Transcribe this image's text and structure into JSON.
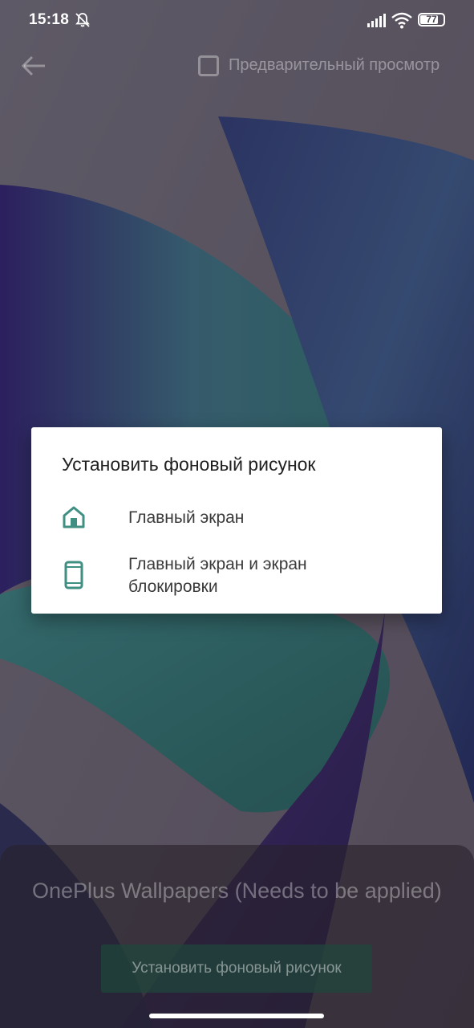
{
  "status_bar": {
    "time": "15:18",
    "battery_level": "77",
    "icons": [
      "bell-off-icon",
      "signal-icon",
      "wifi-icon",
      "battery-icon"
    ]
  },
  "toolbar": {
    "back_icon": "arrow-left-icon",
    "preview_label": "Предварительный просмотр",
    "preview_checked": false
  },
  "wallpaper": {
    "name": "OnePlus Wallpapers (Needs to be applied)",
    "button_label": "Установить фоновый рисунок"
  },
  "dialog": {
    "title": "Установить фоновый рисунок",
    "accent_color": "#3f8f82",
    "options": [
      {
        "icon": "home-icon",
        "label": "Главный экран"
      },
      {
        "icon": "phone-icon",
        "label": "Главный экран и экран блокировки"
      }
    ]
  }
}
